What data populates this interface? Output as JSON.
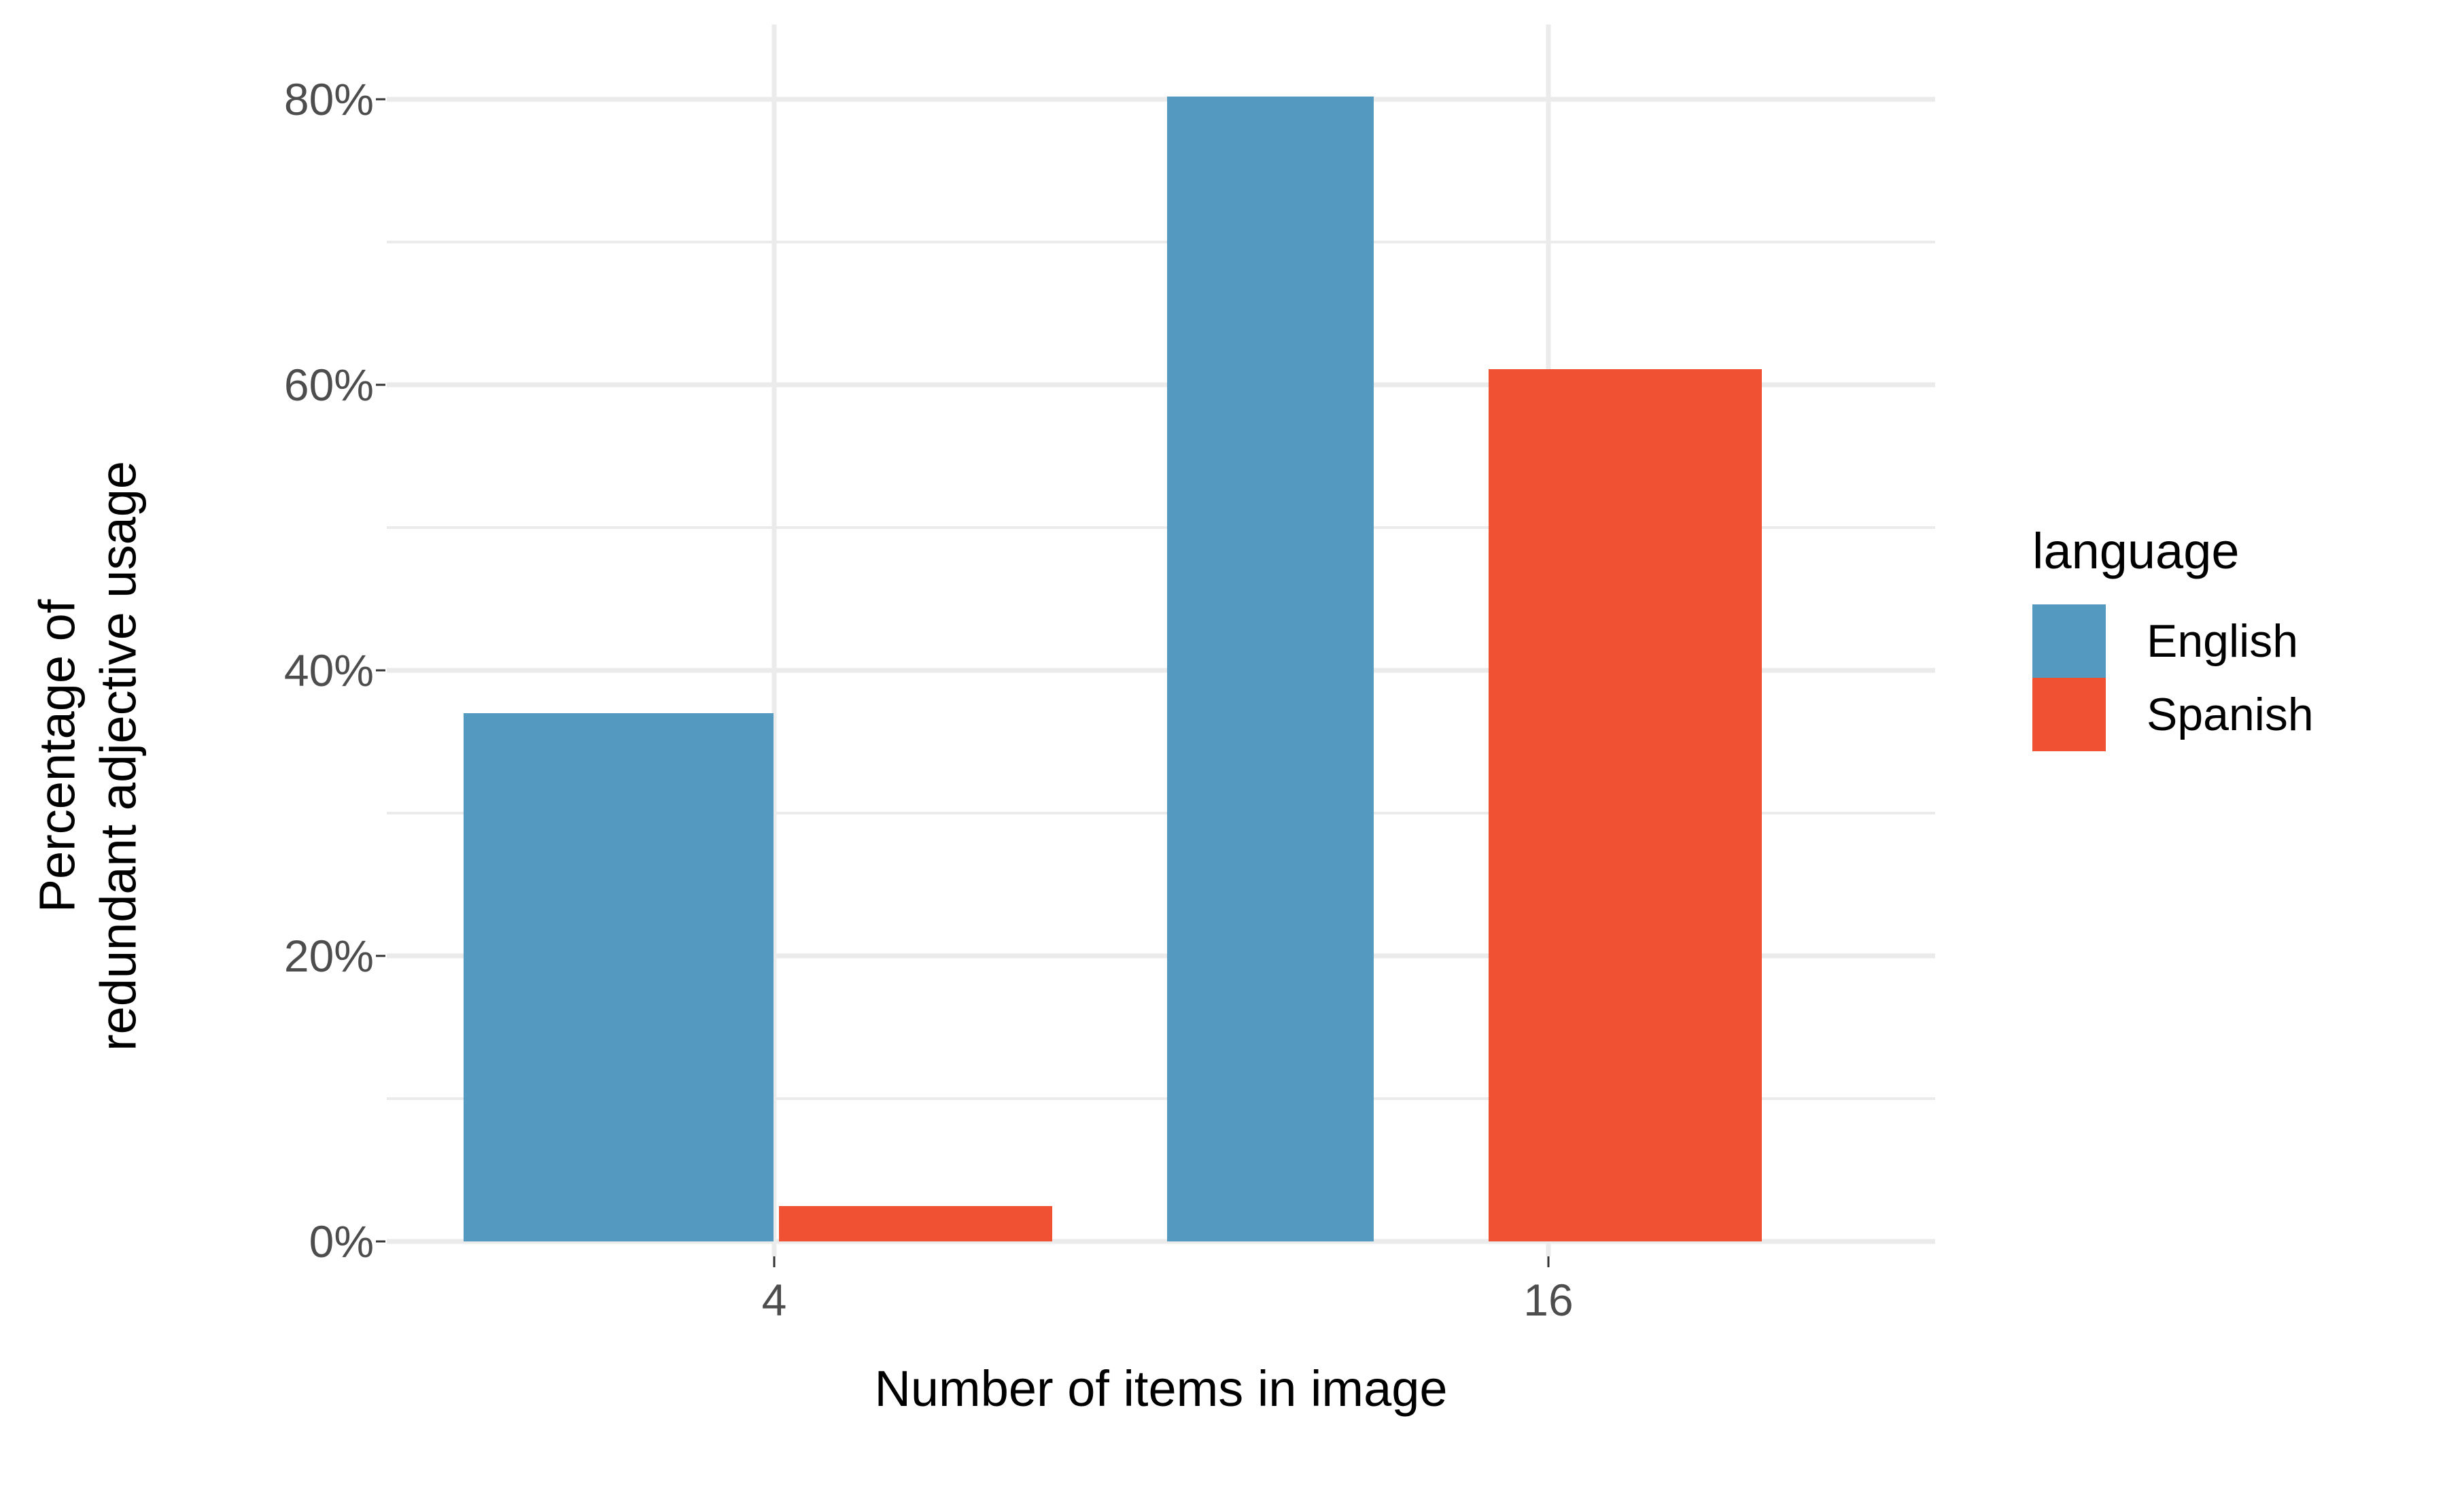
{
  "chart_data": {
    "type": "bar",
    "title": "",
    "subtitle": "",
    "xlabel": "Number of items in image",
    "ylabel": "Percentage of\nredundant adjective usage",
    "ylabel_lines": [
      "Percentage of",
      "redundant adjective usage"
    ],
    "categories": [
      "4",
      "16"
    ],
    "series": [
      {
        "name": "English",
        "color": "#5499C0",
        "values": [
          37.0,
          80.2
        ]
      },
      {
        "name": "Spanish",
        "color": "#EF5132",
        "values": [
          2.5,
          61.1
        ]
      }
    ],
    "ylim": [
      0,
      84
    ],
    "y_ticks": [
      0,
      20,
      40,
      60,
      80
    ],
    "y_tick_labels": [
      "0%",
      "20%",
      "40%",
      "60%",
      "80%"
    ],
    "y_minor_ticks": [
      10,
      30,
      50,
      70
    ],
    "x_tick_labels": [
      "4",
      "16"
    ],
    "grid": true,
    "grid_color": "#EBEBEB",
    "legend": {
      "title": "language",
      "position": "right",
      "entries": [
        {
          "label": "English",
          "color": "#5499C0"
        },
        {
          "label": "Spanish",
          "color": "#EF5132"
        }
      ]
    },
    "background": "#FFFFFF",
    "axis_text_color": "#4D4D4D",
    "axis_title_color": "#000000"
  },
  "axes": {
    "y_tick_labels": [
      "80%",
      "60%",
      "40%",
      "20%",
      "0%"
    ],
    "x_tick_labels": [
      "4",
      "16"
    ],
    "x_title": "Number of items in image",
    "y_title_line1": "Percentage of",
    "y_title_line2": "redundant adjective usage"
  },
  "legend": {
    "title": "language",
    "english_label": "English",
    "spanish_label": "Spanish",
    "english_color": "#5499C0",
    "spanish_color": "#EF5132"
  }
}
